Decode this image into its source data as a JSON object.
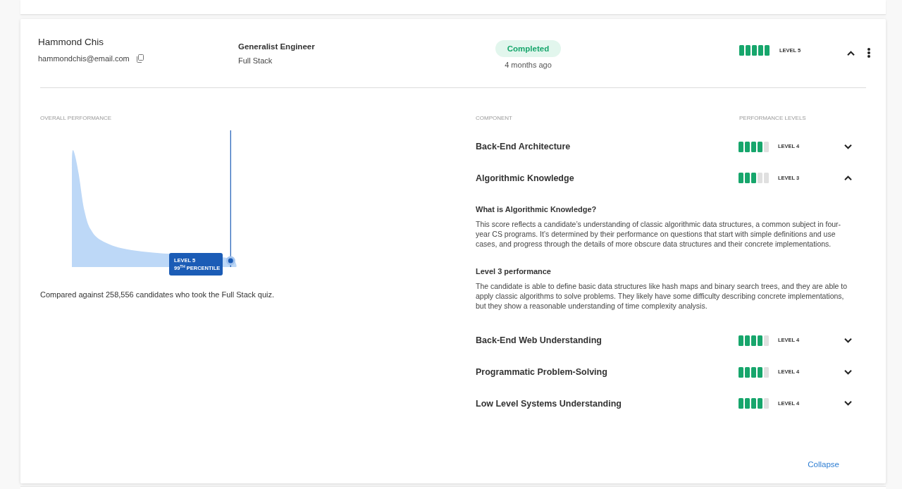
{
  "candidate": {
    "name": "Hammond Chis",
    "email": "hammondchis@email.com"
  },
  "role": {
    "title": "Generalist Engineer",
    "track": "Full Stack"
  },
  "status": {
    "label": "Completed",
    "time": "4 months ago"
  },
  "overall_level": {
    "level": 1,
    "label": "LEVEL 5"
  },
  "expanded": true,
  "overall_performance": {
    "heading": "OVERALL PERFORMANCE",
    "tooltip": {
      "title": "LEVEL 5",
      "subtitle": "99$^{TH}$ PERCENTILE"
    },
    "caption": "Compared against 258,556 candidates who took the Full Stack quiz."
  },
  "components": {
    "columns": [
      "COMPONENT",
      "PERFORMANCE LEVELS"
    ],
    "items": [
      {
        "name": "Back-End Architecture",
        "level": 0.8,
        "level_label": "LEVEL 4",
        "expanded": false
      },
      {
        "name": "Algorithmic Knowledge",
        "level": 0.6,
        "level_label": "LEVEL 3",
        "expanded": true,
        "details": {
          "question": "What is Algorithmic Knowledge?",
          "description": "This score reflects a candidate’s understanding of classic algorithmic data structures, a common subject in four-year CS programs. It’s determined by their performance on questions that start with simple definitions and use cases, and progress through the details of more obscure data structures and their concrete implementations.",
          "performance_heading": "Level 3 performance",
          "performance_text": "The candidate is able to define basic data structures like hash maps and binary search trees, and they are able to apply classic algorithms to solve problems. They likely have some difficulty describing concrete implementations, but they show a reasonable understanding of time complexity analysis."
        }
      },
      {
        "name": "Back-End Web Understanding",
        "level": 0.8,
        "level_label": "LEVEL 4",
        "expanded": false
      },
      {
        "name": "Programmatic Problem-Solving",
        "level": 0.8,
        "level_label": "LEVEL 4",
        "expanded": false
      },
      {
        "name": "Low Level Systems Understanding",
        "level": 0.8,
        "level_label": "LEVEL 4",
        "expanded": false
      }
    ]
  },
  "collapse_link": "Collapse"
}
